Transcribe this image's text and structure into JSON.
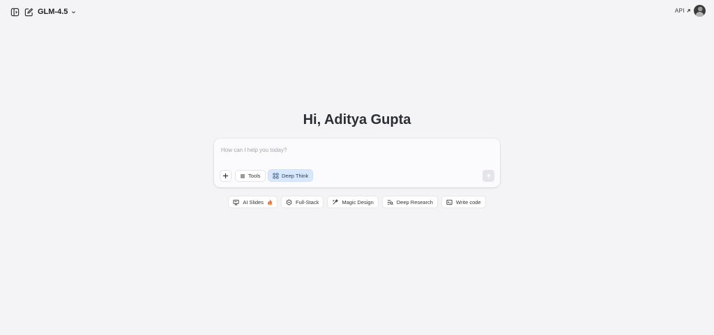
{
  "header": {
    "model_name": "GLM-4.5",
    "api_label": "API",
    "icons": [
      "sidebar-toggle-icon",
      "new-chat-icon",
      "chevron-down-icon",
      "arrow-up-right-icon",
      "avatar"
    ]
  },
  "greeting": "Hi, Aditya Gupta",
  "composer": {
    "placeholder": "How can I help you today?",
    "value": "",
    "tools_label": "Tools",
    "deep_think_label": "Deep Think",
    "deep_think_active": true
  },
  "suggestions": [
    {
      "label": "AI Slides",
      "icon": "slides-icon",
      "badge": "fire-icon"
    },
    {
      "label": "Full-Stack",
      "icon": "fullstack-icon"
    },
    {
      "label": "Magic Design",
      "icon": "magic-design-icon"
    },
    {
      "label": "Deep Research",
      "icon": "deep-research-icon"
    },
    {
      "label": "Write code",
      "icon": "code-window-icon"
    }
  ],
  "colors": {
    "background": "#f4f4f6",
    "active_chip": "#d8e7fb",
    "fire": "#f2652a"
  }
}
